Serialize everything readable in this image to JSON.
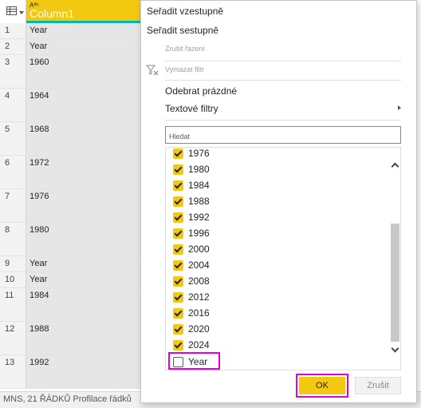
{
  "grid": {
    "column_type_glyph": "Aᴬᶜ",
    "column_header": "Column1",
    "rows": [
      {
        "num": "1",
        "value": "Year"
      },
      {
        "num": "2",
        "value": "Year"
      },
      {
        "num": "3",
        "value": "1960"
      },
      {
        "num": "4",
        "value": "1964"
      },
      {
        "num": "5",
        "value": "1968"
      },
      {
        "num": "6",
        "value": "1972"
      },
      {
        "num": "7",
        "value": "1976"
      },
      {
        "num": "8",
        "value": "1980"
      },
      {
        "num": "9",
        "value": "Year"
      },
      {
        "num": "10",
        "value": "Year"
      },
      {
        "num": "11",
        "value": "1984"
      },
      {
        "num": "12",
        "value": "1988"
      },
      {
        "num": "13",
        "value": "1992"
      }
    ]
  },
  "status_bar": "MNS, 21 ŘÁDKŮ Profilace řádků",
  "menu": {
    "sort_asc": "Seřadit vzestupně",
    "sort_desc": "Seřadit sestupně",
    "clear_sort": "Zrušit řazení",
    "clear_filter": "Vymazat filtr",
    "remove_empty": "Odebrat prázdné",
    "text_filters": "Textové filtry",
    "search_placeholder": "Hledat",
    "values": [
      {
        "label": "1976",
        "checked": true
      },
      {
        "label": "1980",
        "checked": true
      },
      {
        "label": "1984",
        "checked": true
      },
      {
        "label": "1988",
        "checked": true
      },
      {
        "label": "1992",
        "checked": true
      },
      {
        "label": "1996",
        "checked": true
      },
      {
        "label": "2000",
        "checked": true
      },
      {
        "label": "2004",
        "checked": true
      },
      {
        "label": "2008",
        "checked": true
      },
      {
        "label": "2012",
        "checked": true
      },
      {
        "label": "2016",
        "checked": true
      },
      {
        "label": "2020",
        "checked": true
      },
      {
        "label": "2024",
        "checked": true
      },
      {
        "label": "Year",
        "checked": false
      }
    ],
    "ok_label": "OK",
    "cancel_label": "Zrušit"
  },
  "colors": {
    "accent_yellow": "#f2c811",
    "teal_underline": "#01b8aa",
    "highlight_magenta": "#e000e0"
  },
  "icons": [
    "table-icon",
    "clear-filter-icon",
    "submenu-arrow-icon",
    "scroll-up-icon",
    "scroll-down-icon",
    "checkbox-icon"
  ]
}
